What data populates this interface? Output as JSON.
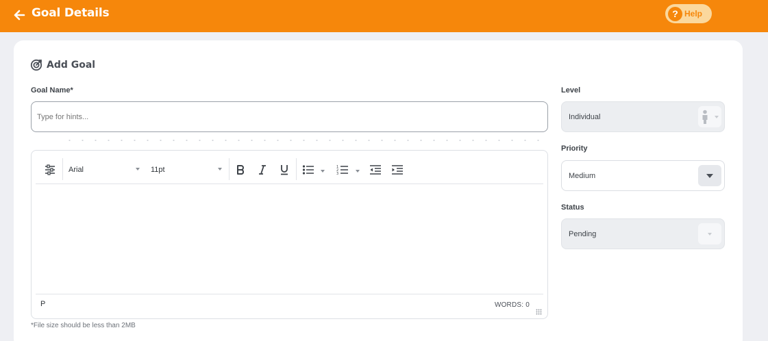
{
  "header": {
    "title": "Goal Details",
    "help_label": "Help",
    "help_glyph": "?",
    "back_icon": "arrow-left-icon"
  },
  "colors": {
    "brand": "#f6870b",
    "help_bg": "#fbd89d",
    "page_bg": "#eeeff3"
  },
  "card": {
    "title": "Add Goal",
    "title_icon": "target-icon"
  },
  "goal_name": {
    "label": "Goal Name*",
    "value": "",
    "placeholder": "Type for hints..."
  },
  "editor": {
    "font_family": "Arial",
    "font_size": "11pt",
    "path": "P",
    "word_count": "WORDS: 0",
    "tools": [
      "settings-sliders-icon",
      "bold-icon",
      "italic-icon",
      "underline-icon",
      "bullet-list-icon",
      "numbered-list-icon",
      "outdent-icon",
      "indent-icon"
    ]
  },
  "file_note": "*File size should be less than 2MB",
  "level": {
    "label": "Level",
    "value": "Individual",
    "icon": "person-icon",
    "disabled": true
  },
  "priority": {
    "label": "Priority",
    "value": "Medium",
    "disabled": false
  },
  "status": {
    "label": "Status",
    "value": "Pending",
    "disabled": true
  }
}
